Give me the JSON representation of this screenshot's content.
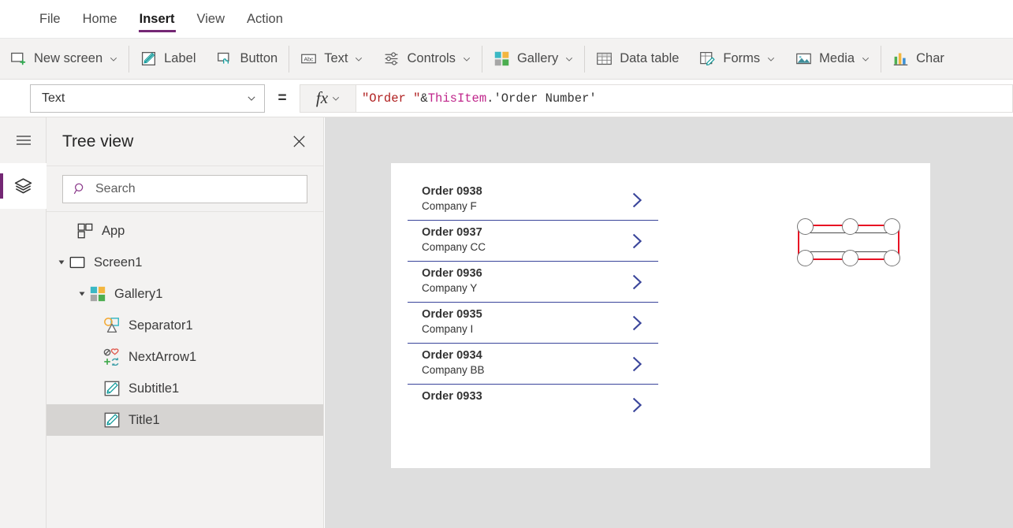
{
  "menubar": {
    "items": [
      {
        "label": "File",
        "active": false
      },
      {
        "label": "Home",
        "active": false
      },
      {
        "label": "Insert",
        "active": true
      },
      {
        "label": "View",
        "active": false
      },
      {
        "label": "Action",
        "active": false
      }
    ]
  },
  "ribbon": {
    "buttons": [
      {
        "label": "New screen",
        "icon": "new-screen-icon",
        "caret": true
      },
      {
        "label": "Label",
        "icon": "label-icon",
        "caret": false
      },
      {
        "label": "Button",
        "icon": "button-icon",
        "caret": false
      },
      {
        "label": "Text",
        "icon": "text-abc-icon",
        "caret": true
      },
      {
        "label": "Controls",
        "icon": "controls-sliders-icon",
        "caret": true
      },
      {
        "label": "Gallery",
        "icon": "gallery-grid-icon",
        "caret": true
      },
      {
        "label": "Data table",
        "icon": "data-table-icon",
        "caret": false
      },
      {
        "label": "Forms",
        "icon": "forms-icon",
        "caret": true
      },
      {
        "label": "Media",
        "icon": "media-image-icon",
        "caret": true
      },
      {
        "label": "Char",
        "icon": "charts-bar-icon",
        "caret": false
      }
    ]
  },
  "formula_bar": {
    "property": "Text",
    "equals": "=",
    "fx_label": "fx",
    "formula_tokens": [
      {
        "text": "\"Order \"",
        "kind": "string"
      },
      {
        "text": " & ",
        "kind": "operator"
      },
      {
        "text": "ThisItem",
        "kind": "object"
      },
      {
        "text": ".'Order Number'",
        "kind": "property"
      }
    ],
    "formula_full": "\"Order \" & ThisItem.'Order Number'"
  },
  "rail": {
    "items": [
      {
        "name": "hamburger-menu-icon",
        "selected": false
      },
      {
        "name": "tree-view-layers-icon",
        "selected": true
      }
    ]
  },
  "tree_panel": {
    "title": "Tree view",
    "close_label": "Close",
    "search": {
      "placeholder": "Search",
      "value": ""
    },
    "items": [
      {
        "label": "App",
        "icon": "app-icon",
        "depth": 0,
        "expander": "none",
        "selected": false
      },
      {
        "label": "Screen1",
        "icon": "screen-icon",
        "depth": 0,
        "expander": "expanded",
        "selected": false
      },
      {
        "label": "Gallery1",
        "icon": "gallery-icon",
        "depth": 1,
        "expander": "expanded",
        "selected": false
      },
      {
        "label": "Separator1",
        "icon": "shapes-icon",
        "depth": 2,
        "expander": "none",
        "selected": false
      },
      {
        "label": "NextArrow1",
        "icon": "icons-icon",
        "depth": 2,
        "expander": "none",
        "selected": false
      },
      {
        "label": "Subtitle1",
        "icon": "label-icon",
        "depth": 2,
        "expander": "none",
        "selected": false
      },
      {
        "label": "Title1",
        "icon": "label-icon",
        "depth": 2,
        "expander": "none",
        "selected": true
      }
    ]
  },
  "canvas": {
    "gallery": {
      "rows": [
        {
          "title": "Order 0938",
          "subtitle": "Company F",
          "selected": true,
          "clipped": false
        },
        {
          "title": "Order 0937",
          "subtitle": "Company CC",
          "selected": false,
          "clipped": false
        },
        {
          "title": "Order 0936",
          "subtitle": "Company Y",
          "selected": false,
          "clipped": false
        },
        {
          "title": "Order 0935",
          "subtitle": "Company I",
          "selected": false,
          "clipped": false
        },
        {
          "title": "Order 0934",
          "subtitle": "Company BB",
          "selected": false,
          "clipped": false
        },
        {
          "title": "Order 0933",
          "subtitle": "",
          "selected": false,
          "clipped": true
        }
      ]
    }
  },
  "colors": {
    "accent_purple": "#742774",
    "selection_red": "#e81123",
    "chevron_navy": "#39449a",
    "ribbon_bg": "#f3f2f1",
    "stage_bg": "#dedede",
    "tree_selected_bg": "#d6d4d2"
  }
}
